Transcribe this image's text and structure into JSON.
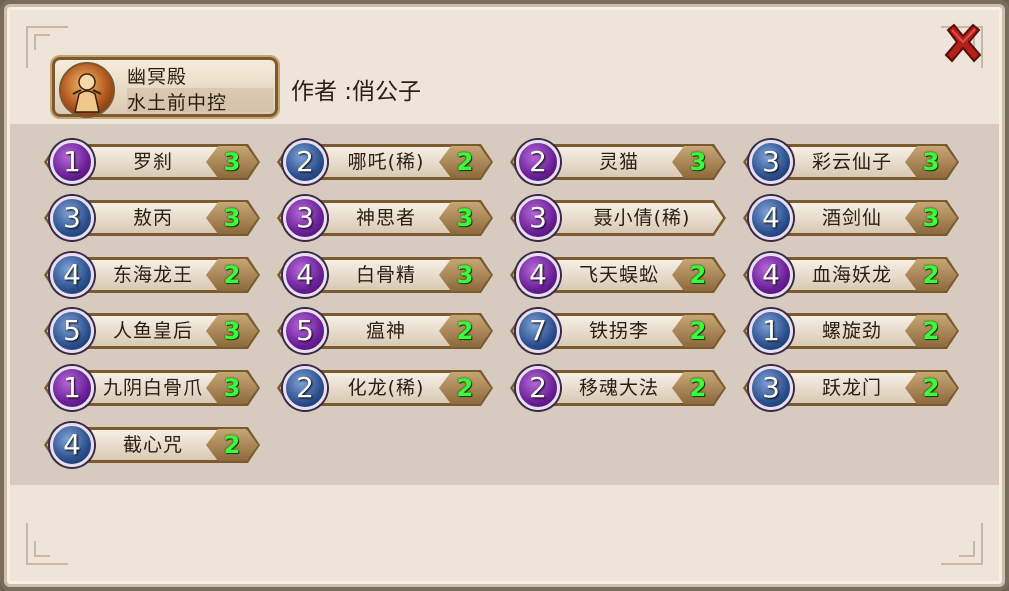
{
  "deck": {
    "name": "幽冥殿",
    "subtitle": "水土前中控",
    "author": "作者 :俏公子"
  },
  "cards": [
    {
      "cost": "1",
      "name": "罗刹",
      "count": "3",
      "color": "purple"
    },
    {
      "cost": "2",
      "name": "哪吒(稀)",
      "count": "2",
      "color": "blue"
    },
    {
      "cost": "2",
      "name": "灵猫",
      "count": "3",
      "color": "purple"
    },
    {
      "cost": "3",
      "name": "彩云仙子",
      "count": "3",
      "color": "blue"
    },
    {
      "cost": "3",
      "name": "敖丙",
      "count": "3",
      "color": "blue"
    },
    {
      "cost": "3",
      "name": "神思者",
      "count": "3",
      "color": "purple"
    },
    {
      "cost": "3",
      "name": "聂小倩(稀)",
      "count": "",
      "color": "purple"
    },
    {
      "cost": "4",
      "name": "酒剑仙",
      "count": "3",
      "color": "blue"
    },
    {
      "cost": "4",
      "name": "东海龙王",
      "count": "2",
      "color": "blue"
    },
    {
      "cost": "4",
      "name": "白骨精",
      "count": "3",
      "color": "purple"
    },
    {
      "cost": "4",
      "name": "飞天蜈蚣",
      "count": "2",
      "color": "purple"
    },
    {
      "cost": "4",
      "name": "血海妖龙",
      "count": "2",
      "color": "purple"
    },
    {
      "cost": "5",
      "name": "人鱼皇后",
      "count": "3",
      "color": "blue"
    },
    {
      "cost": "5",
      "name": "瘟神",
      "count": "2",
      "color": "purple"
    },
    {
      "cost": "7",
      "name": "铁拐李",
      "count": "2",
      "color": "blue"
    },
    {
      "cost": "1",
      "name": "螺旋劲",
      "count": "2",
      "color": "blue"
    },
    {
      "cost": "1",
      "name": "九阴白骨爪",
      "count": "3",
      "color": "purple"
    },
    {
      "cost": "2",
      "name": "化龙(稀)",
      "count": "2",
      "color": "blue"
    },
    {
      "cost": "2",
      "name": "移魂大法",
      "count": "2",
      "color": "purple"
    },
    {
      "cost": "3",
      "name": "跃龙门",
      "count": "2",
      "color": "blue"
    },
    {
      "cost": "4",
      "name": "截心咒",
      "count": "2",
      "color": "blue"
    }
  ],
  "colors": {
    "count_text": "#39ff39",
    "cost_purple": "#6a1f98",
    "cost_blue": "#2c4f8e",
    "close_red": "#b3201a"
  },
  "icons": {
    "close": "close-icon",
    "avatar": "hero-portrait-icon"
  }
}
